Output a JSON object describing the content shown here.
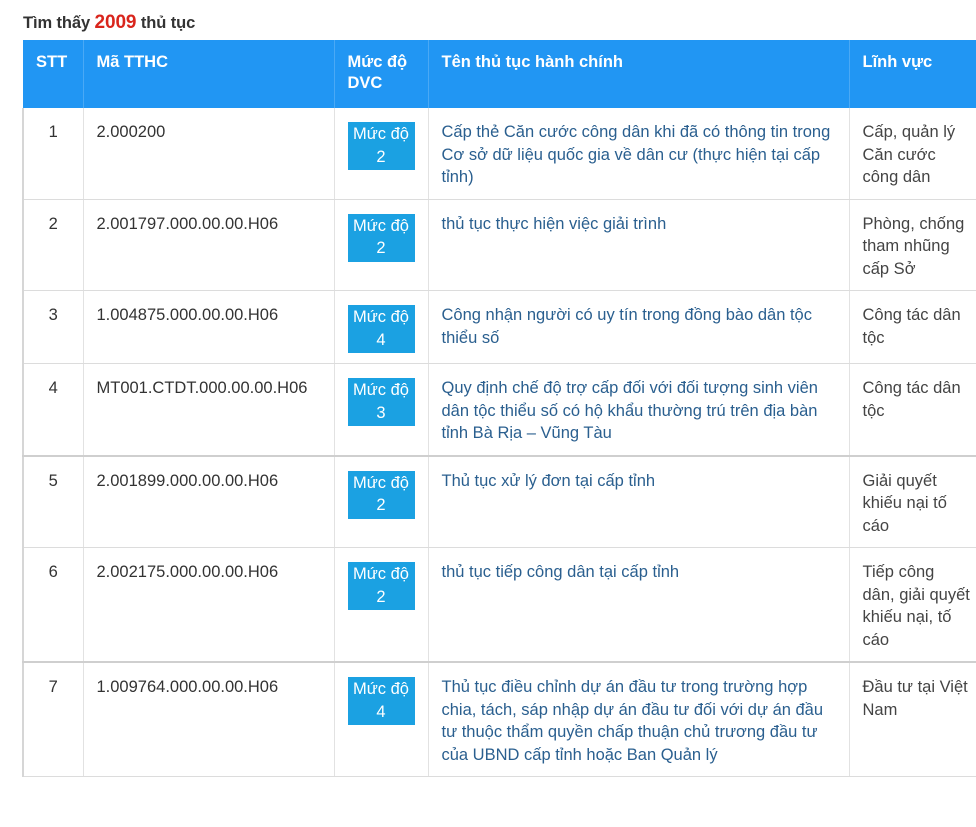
{
  "result_summary": {
    "prefix": "Tìm thấy",
    "count": "2009",
    "suffix": "thủ tục"
  },
  "table": {
    "headers": {
      "stt": "STT",
      "code": "Mã TTHC",
      "level": "Mức độ DVC",
      "name": "Tên thủ tục hành chính",
      "field": "Lĩnh vực"
    },
    "rows": [
      {
        "stt": "1",
        "code": "2.000200",
        "level": "Mức độ 2",
        "name": "Cấp thẻ Căn cước công dân khi đã có thông tin trong Cơ sở dữ liệu quốc gia về dân cư (thực hiện tại cấp tỉnh)",
        "field": "Cấp, quản lý Căn cước công dân"
      },
      {
        "stt": "2",
        "code": "2.001797.000.00.00.H06",
        "level": "Mức độ 2",
        "name": "thủ tục thực hiện việc giải trình",
        "field": "Phòng, chống tham nhũng cấp Sở"
      },
      {
        "stt": "3",
        "code": "1.004875.000.00.00.H06",
        "level": "Mức độ 4",
        "name": "Công nhận người có uy tín trong đồng bào dân tộc thiểu số",
        "field": "Công tác dân tộc"
      },
      {
        "stt": "4",
        "code": "MT001.CTDT.000.00.00.H06",
        "level": "Mức độ 3",
        "name": "Quy định chế độ trợ cấp đối với đối tượng sinh viên dân tộc thiểu số có hộ khẩu thường trú trên địa bàn tỉnh Bà Rịa – Vũng Tàu",
        "field": "Công tác dân tộc"
      },
      {
        "stt": "5",
        "code": "2.001899.000.00.00.H06",
        "level": "Mức độ 2",
        "name": "Thủ tục xử lý đơn tại cấp tỉnh",
        "field": "Giải quyết khiếu nại tố cáo"
      },
      {
        "stt": "6",
        "code": "2.002175.000.00.00.H06",
        "level": "Mức độ 2",
        "name": "thủ tục tiếp công dân tại cấp tỉnh",
        "field": "Tiếp công dân, giải quyết khiếu nại, tố cáo"
      },
      {
        "stt": "7",
        "code": "1.009764.000.00.00.H06",
        "level": "Mức độ 4",
        "name": "Thủ tục điều chỉnh dự án đầu tư trong trường hợp chia, tách, sáp nhập dự án đầu tư đối với dự án đầu tư thuộc thẩm quyền chấp thuận chủ trương đầu tư của UBND cấp tỉnh hoặc Ban Quản lý",
        "field": "Đầu tư tại Việt Nam"
      }
    ]
  },
  "colors": {
    "header_bg": "#2196f3",
    "badge_bg": "#1ba1e2",
    "link": "#2a5f8f",
    "count": "#d9251c"
  }
}
